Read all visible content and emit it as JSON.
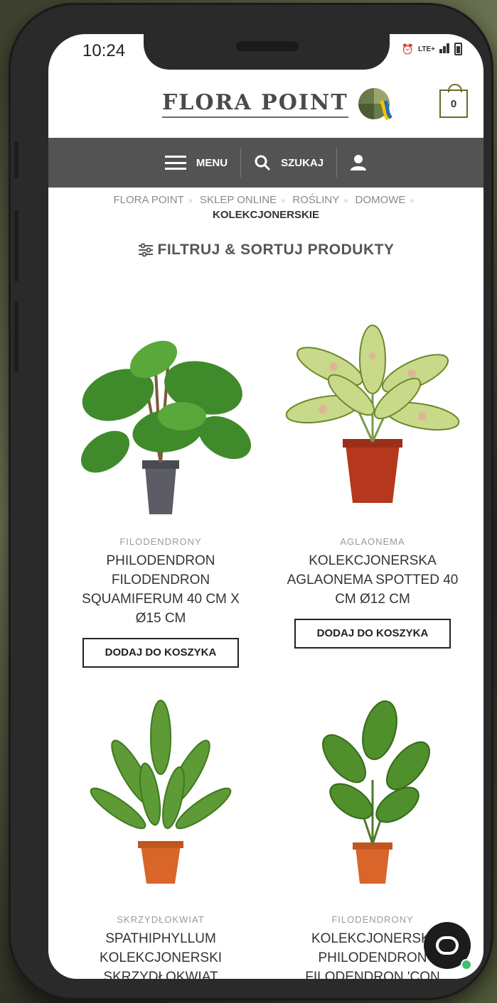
{
  "status": {
    "time": "10:24",
    "network": "LTE+"
  },
  "header": {
    "logo_text": "FLORA POINT",
    "cart_count": "0"
  },
  "nav": {
    "menu_label": "MENU",
    "search_label": "SZUKAJ"
  },
  "breadcrumb": {
    "items": [
      "FLORA POINT",
      "SKLEP ONLINE",
      "ROŚLINY",
      "DOMOWE"
    ],
    "current": "KOLEKCJONERSKIE"
  },
  "filter": {
    "label": "FILTRUJ & SORTUJ PRODUKTY"
  },
  "products": [
    {
      "category": "FILODENDRONY",
      "title": "PHILODENDRON FILODENDRON SQUAMIFERUM 40 CM X Ø15 CM",
      "button": "DODAJ DO KOSZYKA"
    },
    {
      "category": "AGLAONEMA",
      "title": "KOLEKCJONERSKA AGLAONEMA SPOTTED 40 CM Ø12 CM",
      "button": "DODAJ DO KOSZYKA"
    },
    {
      "category": "SKRZYDŁOKWIAT",
      "title": "SPATHIPHYLLUM KOLEKCJONERSKI SKRZYDŁOKWIAT",
      "button": ""
    },
    {
      "category": "FILODENDRONY",
      "title": "KOLEKCJONERSKI PHILODENDRON FILODENDRON 'CON",
      "button": ""
    }
  ],
  "colors": {
    "nav_bg": "#535353",
    "accent": "#6b6a2a",
    "chat": "#1c1c1c",
    "online": "#43c16a"
  }
}
